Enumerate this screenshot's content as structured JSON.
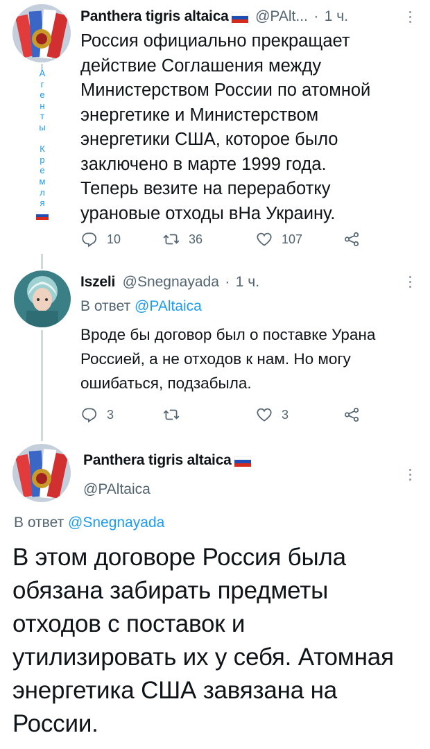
{
  "tweet1": {
    "author": "Panthera tigris altaica",
    "handle": "@PAlt...",
    "sep": "·",
    "time": "1 ч.",
    "bio_vertical": [
      "А",
      "г",
      "е",
      "н",
      "т",
      "ы",
      "",
      "К",
      "р",
      "е",
      "м",
      "л",
      "я"
    ],
    "text": "Россия официально прекращает действие Соглашения между Министерством России по атомной энергетике и Министерством энергетики США, которое было заключено в марте 1999 года. Теперь везите на переработку урановые отходы вНа Украину.",
    "replies": "10",
    "retweets": "36",
    "likes": "107"
  },
  "tweet2": {
    "author": "Iszeli",
    "handle": "@Snegnayada",
    "sep": "·",
    "time": "1 ч.",
    "reply_prefix": "В ответ",
    "reply_to": "@PAltaica",
    "text": "Вроде бы договор был о поставке Урана Россией, а не отходов к нам. Но могу ошибаться, подзабыла.",
    "replies": "3",
    "retweets": "",
    "likes": "3"
  },
  "tweet3": {
    "author": "Panthera tigris altaica",
    "handle": "@PAltaica",
    "reply_prefix": "В ответ",
    "reply_to": "@Snegnayada",
    "text": "В этом договоре Россия была обязана забирать предметы отходов с поставок и утилизировать их у себя. Атомная энергетика США завязана на России."
  },
  "icons": {
    "reply": "reply-icon",
    "retweet": "retweet-icon",
    "like": "heart-icon",
    "share": "share-icon",
    "more": "more-vertical-icon",
    "flag": "russia-flag-icon"
  },
  "colors": {
    "accent": "#1d9bf0",
    "secondary_text": "#536471",
    "thread_line": "#cfd9de"
  }
}
